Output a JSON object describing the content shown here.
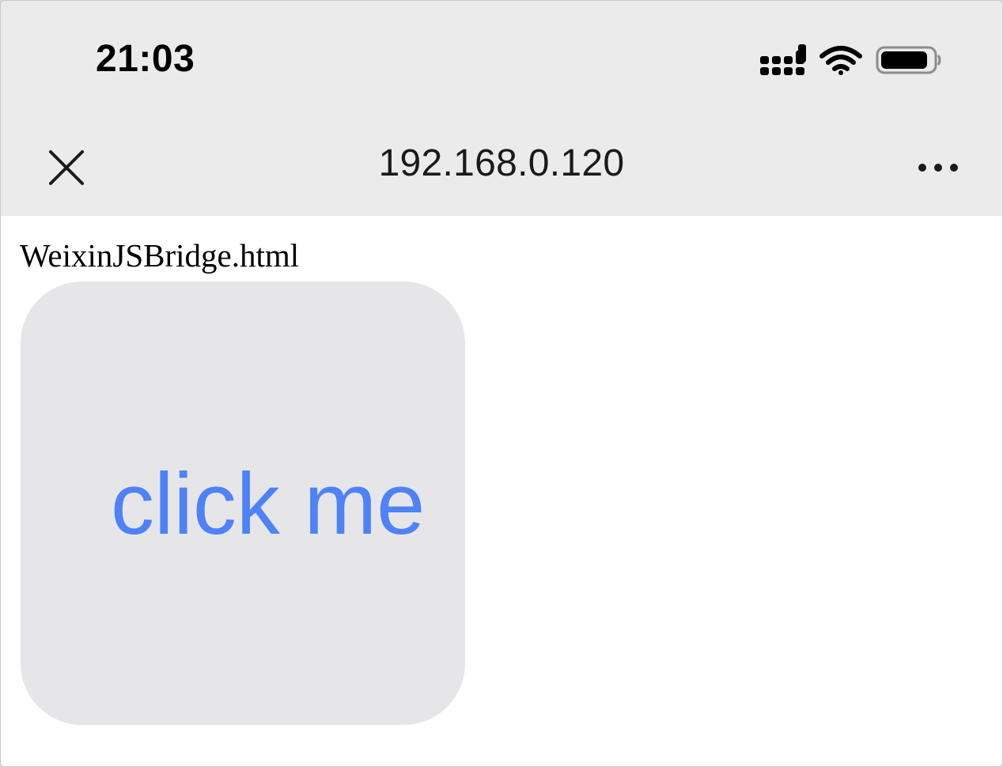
{
  "status_bar": {
    "time": "21:03",
    "icons": [
      "cellular-signal-icon",
      "wifi-icon",
      "battery-icon"
    ]
  },
  "nav_bar": {
    "title": "192.168.0.120",
    "close_icon": "close-icon",
    "more_icon": "more-icon"
  },
  "page": {
    "heading": "WeixinJSBridge.html",
    "button_label": "click me"
  },
  "colors": {
    "chrome_background": "#ebebeb",
    "button_background": "#e6e6e9",
    "button_text": "#4f81f7"
  }
}
